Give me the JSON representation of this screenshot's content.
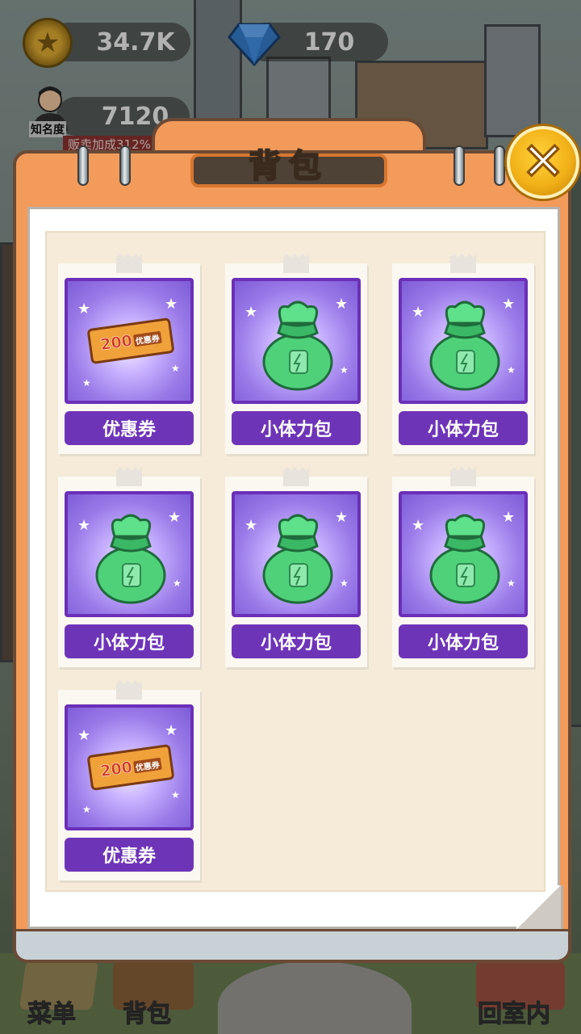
{
  "hud": {
    "coins": "34.7K",
    "gems": "170",
    "fame": "7120",
    "fame_label": "知名度",
    "sale_banner": "贩卖加成312%"
  },
  "panel": {
    "title": "背包",
    "close_glyph": "✕"
  },
  "items": [
    {
      "label": "优惠券",
      "icon": "coupon-icon",
      "coupon_value": "200",
      "coupon_text": "优惠券"
    },
    {
      "label": "小体力包",
      "icon": "stamina-bag-icon"
    },
    {
      "label": "小体力包",
      "icon": "stamina-bag-icon"
    },
    {
      "label": "小体力包",
      "icon": "stamina-bag-icon"
    },
    {
      "label": "小体力包",
      "icon": "stamina-bag-icon"
    },
    {
      "label": "小体力包",
      "icon": "stamina-bag-icon"
    },
    {
      "label": "优惠券",
      "icon": "coupon-icon",
      "coupon_value": "200",
      "coupon_text": "优惠券"
    }
  ],
  "bottom_nav": {
    "menu": "菜单",
    "bag": "背包",
    "home": "回室内"
  },
  "colors": {
    "panel_orange": "#f39b5b",
    "item_purple": "#6e34b8",
    "close_gold": "#f2b118"
  }
}
